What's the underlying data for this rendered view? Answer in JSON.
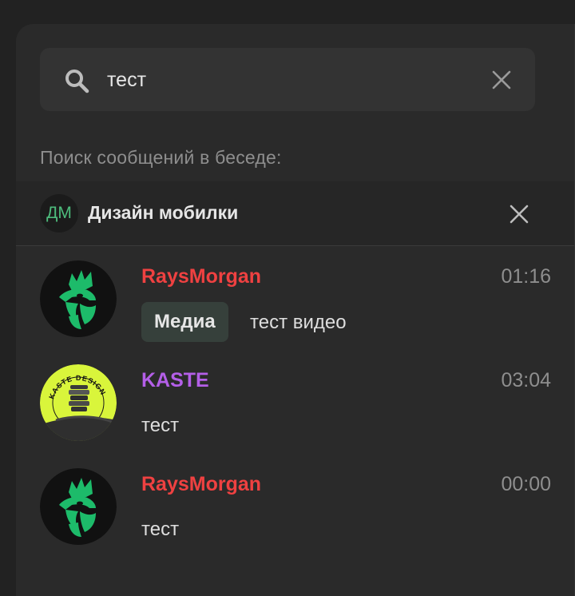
{
  "search": {
    "query": "тест"
  },
  "section_label": "Поиск сообщений в беседе:",
  "chat": {
    "avatar_initials": "ДМ",
    "title": "Дизайн мобилки"
  },
  "results": [
    {
      "author": "RaysMorgan",
      "author_color": "#ef4141",
      "time": "01:16",
      "media_badge": "Медиа",
      "text": "тест видео",
      "avatar": "rooster-logo"
    },
    {
      "author": "KASTE",
      "author_color": "#b45fe8",
      "time": "03:04",
      "text": "тест",
      "avatar": "kaste-design-logo",
      "avatar_text": "KASTE DESIGN"
    },
    {
      "author": "RaysMorgan",
      "author_color": "#ef4141",
      "time": "00:00",
      "text": "тест",
      "avatar": "rooster-logo"
    }
  ],
  "colors": {
    "background": "#222222",
    "panel": "#2a2a2a",
    "accent_green": "#1dbb6a",
    "badge_bg": "#36403b"
  }
}
